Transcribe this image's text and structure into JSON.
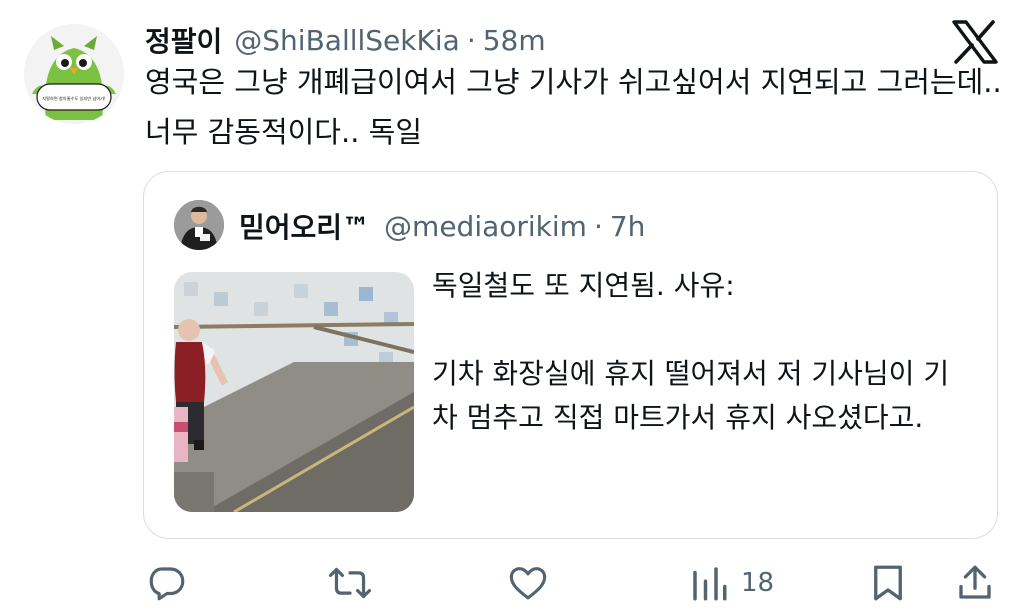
{
  "tweet": {
    "display_name": "정팔이",
    "handle": "@ShiBalllSekKia",
    "separator": "·",
    "time": "58m",
    "text": "영국은 그냥 개폐급이여서 그냥 기사가 쉬고싶어서 지연되고 그러는데.. 너무 감동적이다.. 독일",
    "avatar_caption": "지랄하면 참아줄수도 있지만 넘어가!"
  },
  "quote": {
    "display_name": "믿어오리™",
    "handle": "@mediaorikim",
    "separator": "·",
    "time": "7h",
    "text_line1": "독일철도 또 지연됨. 사유:",
    "text_line2": "기차 화장실에 휴지 떨어져서 저 기사님이 기차 멈추고 직접 마트가서 휴지 사오셨다고."
  },
  "actions": {
    "views_count": "18"
  },
  "icons": {
    "platform_logo": "x-logo-icon",
    "reply": "reply-icon",
    "retweet": "retweet-icon",
    "like": "heart-icon",
    "views": "views-chart-icon",
    "bookmark": "bookmark-icon",
    "share": "share-icon"
  },
  "colors": {
    "text_primary": "#0f1419",
    "text_secondary": "#536471",
    "border": "#d8dee3",
    "avatar_owl": "#7cc242"
  }
}
